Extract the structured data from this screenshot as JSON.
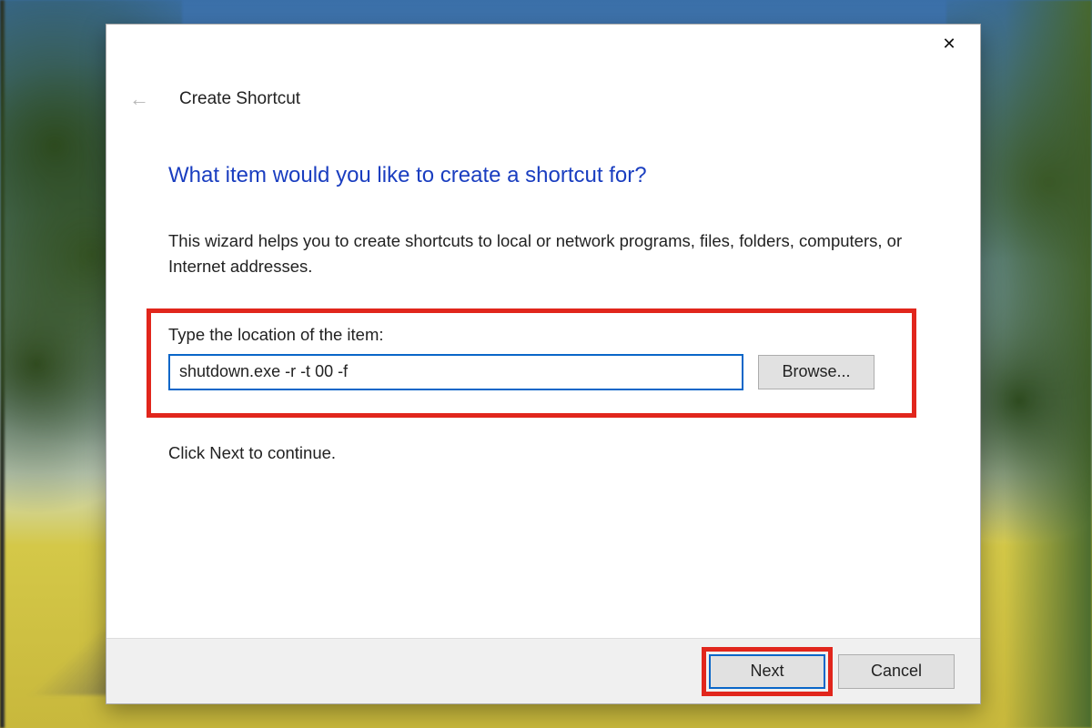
{
  "dialog": {
    "wizard_title": "Create Shortcut",
    "close_symbol": "✕",
    "back_symbol": "←",
    "question": "What item would you like to create a shortcut for?",
    "description": "This wizard helps you to create shortcuts to local or network programs, files, folders, computers, or Internet addresses.",
    "input_label": "Type the location of the item:",
    "location_value": "shutdown.exe -r -t 00 -f",
    "browse_label": "Browse...",
    "continue_text": "Click Next to continue.",
    "next_label": "Next",
    "cancel_label": "Cancel"
  },
  "annotations": {
    "highlight_color": "#e1261c",
    "highlighted_elements": [
      "location-input-section",
      "next-button"
    ]
  }
}
